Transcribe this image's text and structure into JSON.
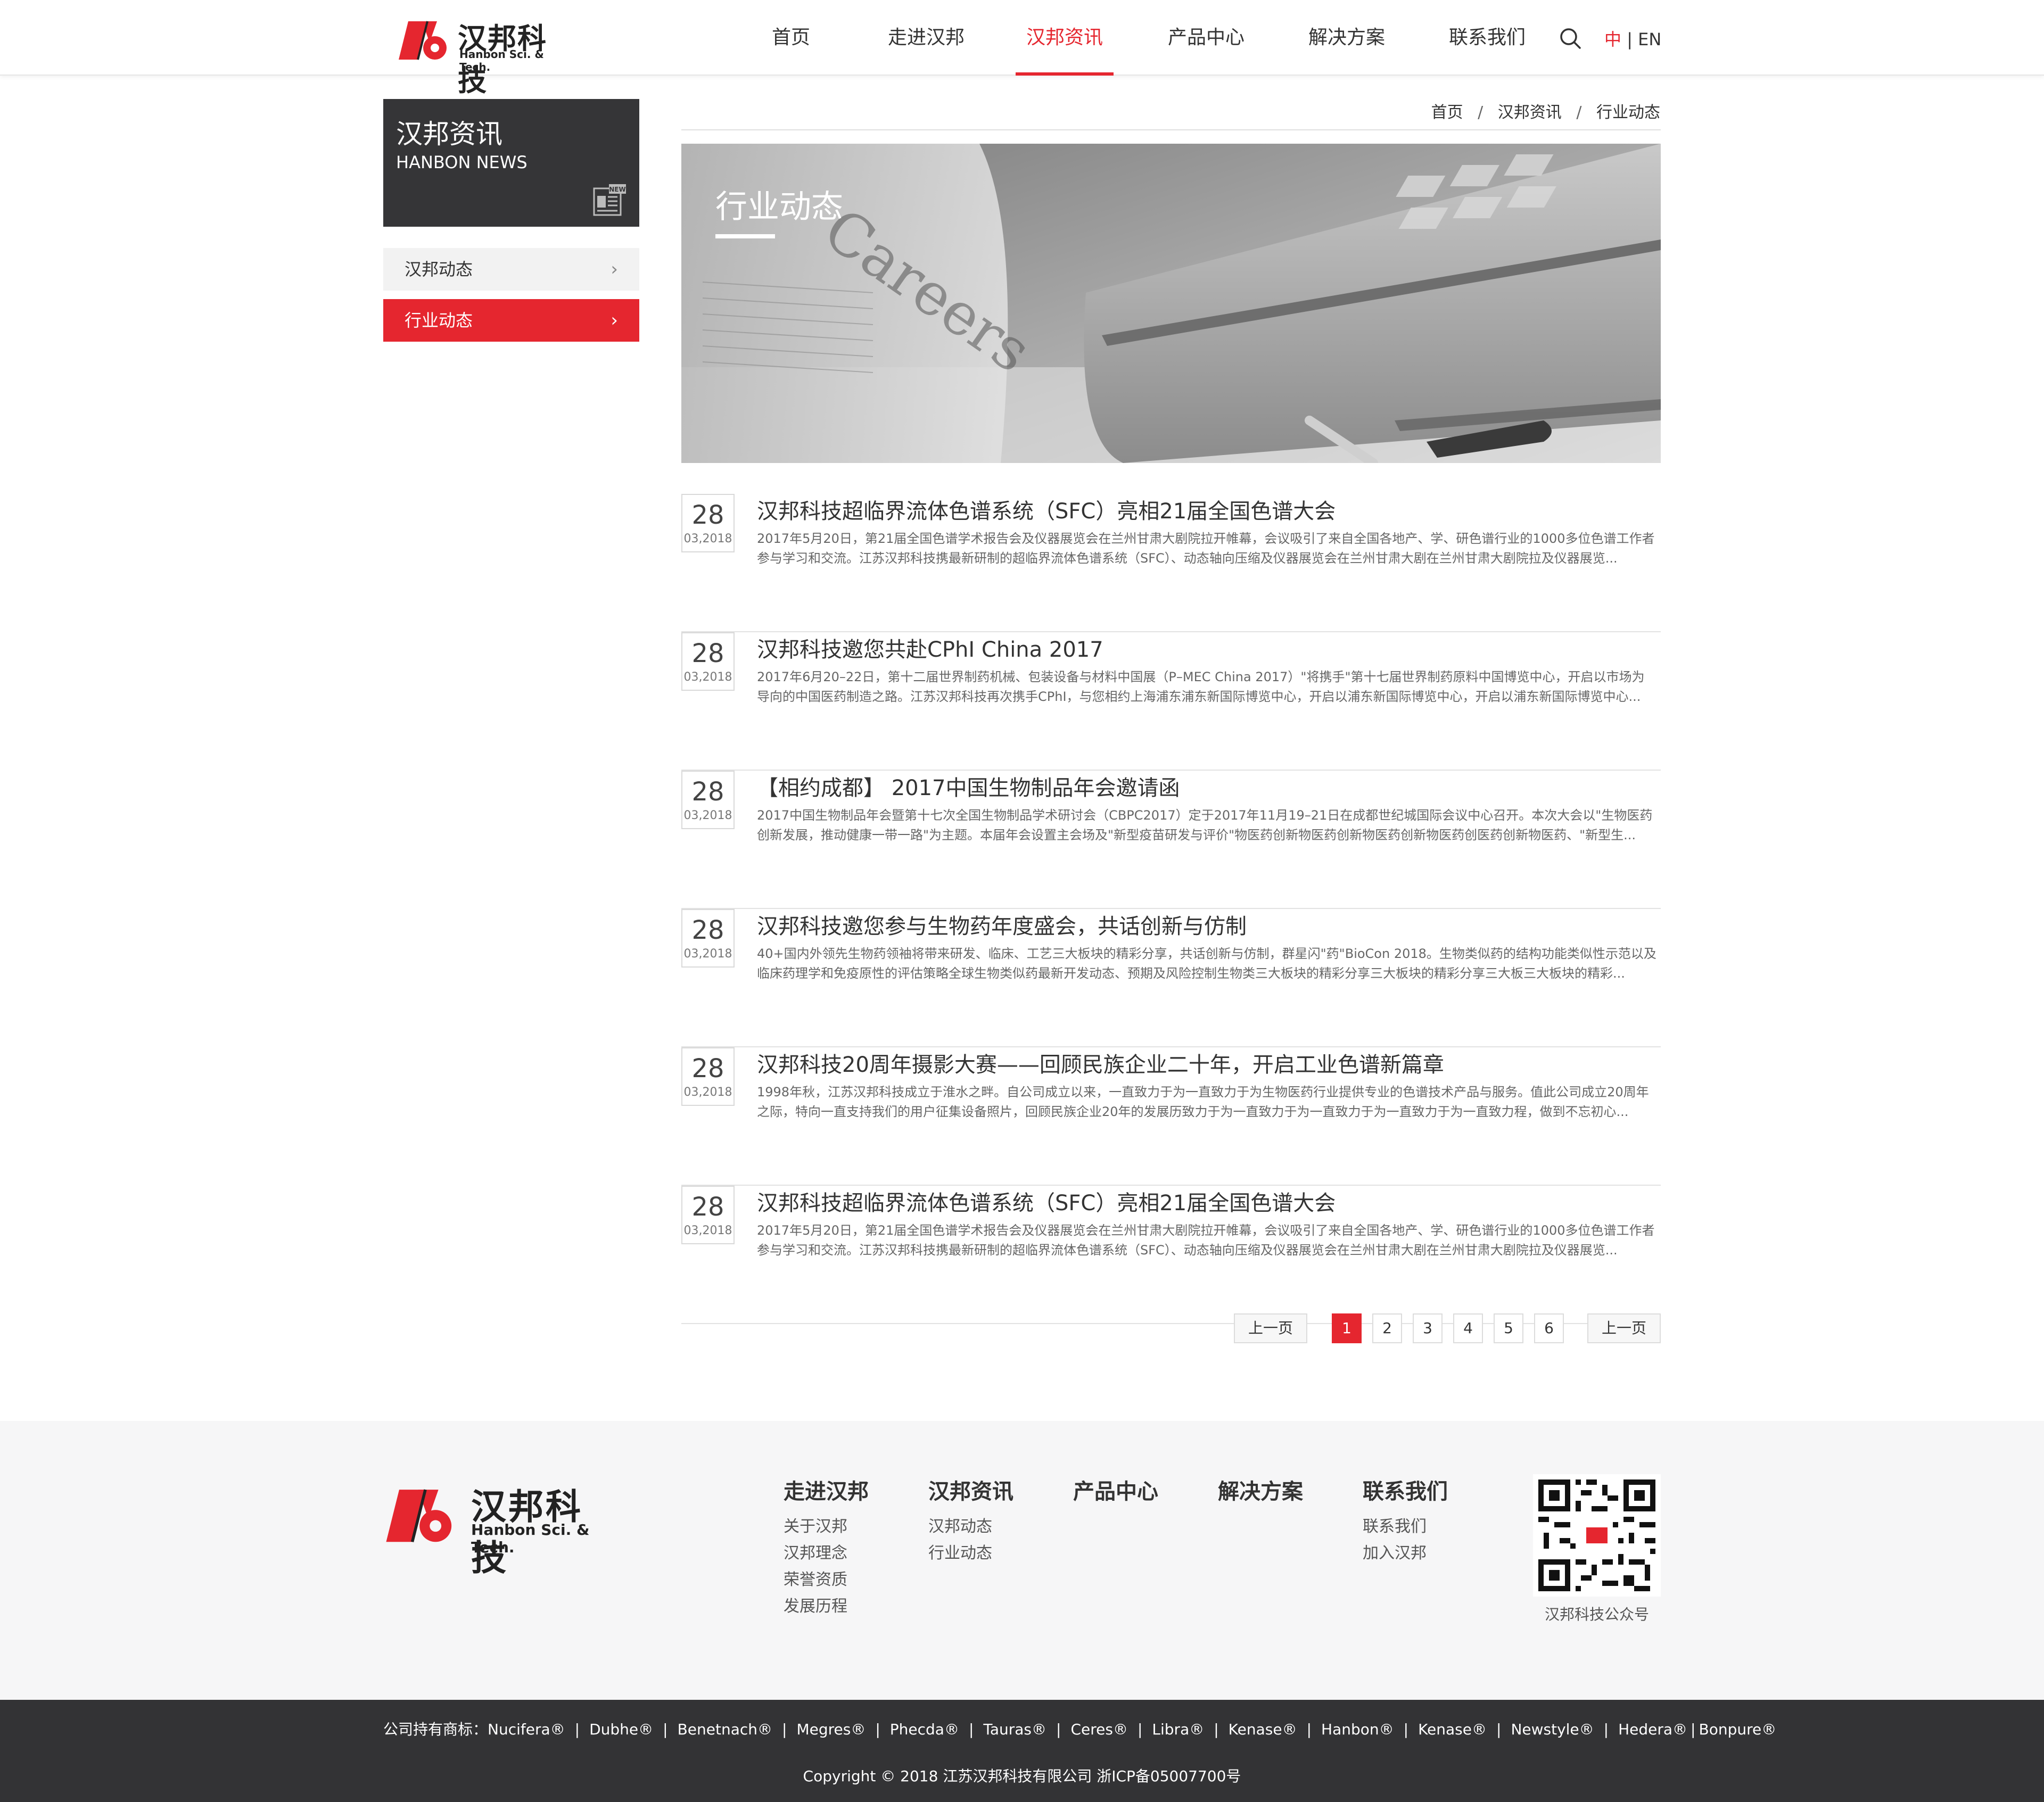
{
  "header": {
    "logo_cn": "汉邦科技",
    "logo_en": "Hanbon Sci. & Tech.",
    "nav": [
      {
        "label": "首页"
      },
      {
        "label": "走进汉邦"
      },
      {
        "label": "汉邦资讯"
      },
      {
        "label": "产品中心"
      },
      {
        "label": "解决方案"
      },
      {
        "label": "联系我们"
      }
    ],
    "active_nav": "汉邦资讯",
    "lang_zh": "中",
    "lang_sep": "|",
    "lang_en": "EN",
    "search_icon": "search-icon"
  },
  "colors": {
    "accent": "#e5262f",
    "sidebar_head_bg": "#353537",
    "footer_bg": "#f6f6f7",
    "bottom_bar_bg": "#333335"
  },
  "sidebar": {
    "title_cn": "汉邦资讯",
    "title_en": "HANBON NEWS",
    "icon": "newspaper-icon",
    "icon_label": "NEW",
    "items": [
      {
        "label": "汉邦动态",
        "active": false
      },
      {
        "label": "行业动态",
        "active": true
      }
    ]
  },
  "breadcrumb": [
    "首页",
    "汉邦资讯",
    "行业动态"
  ],
  "breadcrumb_sep": "/",
  "banner": {
    "title": "行业动态",
    "newspaper_word": "Careers"
  },
  "news": [
    {
      "day": "28",
      "ym": "03,2018",
      "title": "汉邦科技超临界流体色谱系统（SFC）亮相21届全国色谱大会",
      "desc": "2017年5月20日，第21届全国色谱学术报告会及仪器展览会在兰州甘肃大剧院拉开帷幕，会议吸引了来自全国各地产、学、研色谱行业的1000多位色谱工作者参与学习和交流。江苏汉邦科技携最新研制的超临界流体色谱系统（SFC）、动态轴向压缩及仪器展览会在兰州甘肃大剧在兰州甘肃大剧院拉及仪器展览..."
    },
    {
      "day": "28",
      "ym": "03,2018",
      "title": "汉邦科技邀您共赴CPhI China 2017",
      "desc": "2017年6月20–22日，第十二届世界制药机械、包装设备与材料中国展（P–MEC China 2017）\"将携手\"第十七届世界制药原料中国博览中心，开启以市场为导向的中国医药制造之路。江苏汉邦科技再次携手CPhI，与您相约上海浦东浦东新国际博览中心，开启以浦东新国际博览中心，开启以浦东新国际博览中心..."
    },
    {
      "day": "28",
      "ym": "03,2018",
      "title": "【相约成都】 2017中国生物制品年会邀请函",
      "desc": "2017中国生物制品年会暨第十七次全国生物制品学术研讨会（CBPC2017）定于2017年11月19–21日在成都世纪城国际会议中心召开。本次大会以\"生物医药创新发展，推动健康一带一路\"为主题。本届年会设置主会场及\"新型疫苗研发与评价\"物医药创新物医药创新物医药创新物医药创医药创新物医药、\"新型生..."
    },
    {
      "day": "28",
      "ym": "03,2018",
      "title": "汉邦科技邀您参与生物药年度盛会，共话创新与仿制",
      "desc": "40+国内外领先生物药领袖将带来研发、临床、工艺三大板块的精彩分享，共话创新与仿制，群星闪\"药\"BioCon 2018。生物类似药的结构功能类似性示范以及临床药理学和免疫原性的评估策略全球生物类似药最新开发动态、预期及风险控制生物类三大板块的精彩分享三大板块的精彩分享三大板三大板块的精彩..."
    },
    {
      "day": "28",
      "ym": "03,2018",
      "title": "汉邦科技20周年摄影大赛——回顾民族企业二十年，开启工业色谱新篇章",
      "desc": "1998年秋，江苏汉邦科技成立于淮水之畔。自公司成立以来，一直致力于为一直致力于为生物医药行业提供专业的色谱技术产品与服务。值此公司成立20周年之际，特向一直支持我们的用户征集设备照片，回顾民族企业20年的发展历致力于为一直致力于为一直致力于为一直致力于为一直致力程，做到不忘初心..."
    },
    {
      "day": "28",
      "ym": "03,2018",
      "title": "汉邦科技超临界流体色谱系统（SFC）亮相21届全国色谱大会",
      "desc": "2017年5月20日，第21届全国色谱学术报告会及仪器展览会在兰州甘肃大剧院拉开帷幕，会议吸引了来自全国各地产、学、研色谱行业的1000多位色谱工作者参与学习和交流。江苏汉邦科技携最新研制的超临界流体色谱系统（SFC）、动态轴向压缩及仪器展览会在兰州甘肃大剧在兰州甘肃大剧院拉及仪器展览..."
    }
  ],
  "pagination": {
    "prev_label": "上一页",
    "next_label": "上一页",
    "pages": [
      "1",
      "2",
      "3",
      "4",
      "5",
      "6"
    ],
    "current": "1"
  },
  "footer": {
    "logo_cn": "汉邦科技",
    "logo_en": "Hanbon Sci. & Tech.",
    "columns": [
      {
        "title": "走进汉邦",
        "links": [
          "关于汉邦",
          "汉邦理念",
          "荣誉资质",
          "发展历程"
        ]
      },
      {
        "title": "汉邦资讯",
        "links": [
          "汉邦动态",
          "行业动态"
        ]
      },
      {
        "title": "产品中心",
        "links": []
      },
      {
        "title": "解决方案",
        "links": []
      },
      {
        "title": "联系我们",
        "links": [
          "联系我们",
          "加入汉邦"
        ]
      }
    ],
    "qr_caption": "汉邦科技公众号",
    "qr_icon": "qr-code-icon"
  },
  "bottom": {
    "trademark_prefix": "公司持有商标：",
    "trademarks": [
      "Nucifera®",
      "Dubhe®",
      "Benetnach®",
      "Megres®",
      "Phecda®",
      "Tauras®",
      "Ceres®",
      "Libra®",
      "Kenase®",
      "Hanbon®",
      "Kenase®",
      "Newstyle®",
      "Hedera®",
      "Bonpure®"
    ],
    "copyright": "Copyright © 2018 江苏汉邦科技有限公司 浙ICP备05007700号"
  }
}
